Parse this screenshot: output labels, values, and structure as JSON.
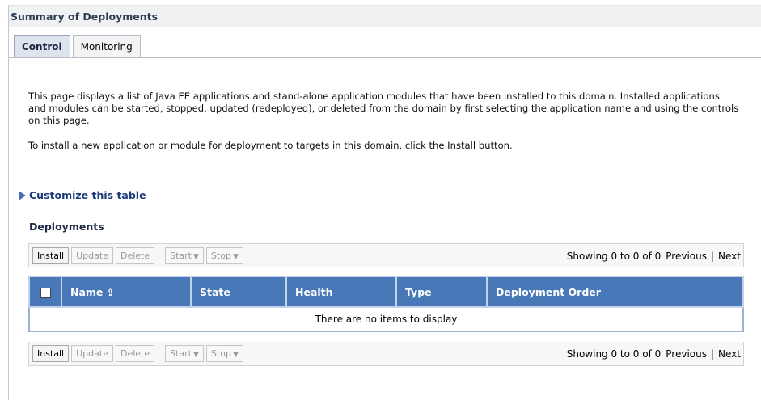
{
  "header": {
    "title": "Summary of Deployments"
  },
  "tabs": [
    {
      "label": "Control",
      "active": true
    },
    {
      "label": "Monitoring",
      "active": false
    }
  ],
  "description": {
    "paragraph1": "This page displays a list of Java EE applications and stand-alone application modules that have been installed to this domain. Installed applications and modules can be started, stopped, updated (redeployed), or deleted from the domain by first selecting the application name and using the controls on this page.",
    "paragraph2": "To install a new application or module for deployment to targets in this domain, click the Install button."
  },
  "customize": {
    "label": "Customize this table",
    "icon": "expand-triangle-icon"
  },
  "deployments": {
    "title": "Deployments",
    "toolbar": {
      "install": "Install",
      "update": "Update",
      "delete": "Delete",
      "start": "Start",
      "stop": "Stop"
    },
    "pager": {
      "showing": "Showing 0 to 0 of 0",
      "previous": "Previous",
      "separator": "|",
      "next": "Next"
    },
    "columns": [
      "Name",
      "State",
      "Health",
      "Type",
      "Deployment Order"
    ],
    "empty_message": "There are no items to display"
  },
  "colors": {
    "table_header": "#4878b8",
    "link": "#1a3a78",
    "header_text": "#2f3d55"
  }
}
